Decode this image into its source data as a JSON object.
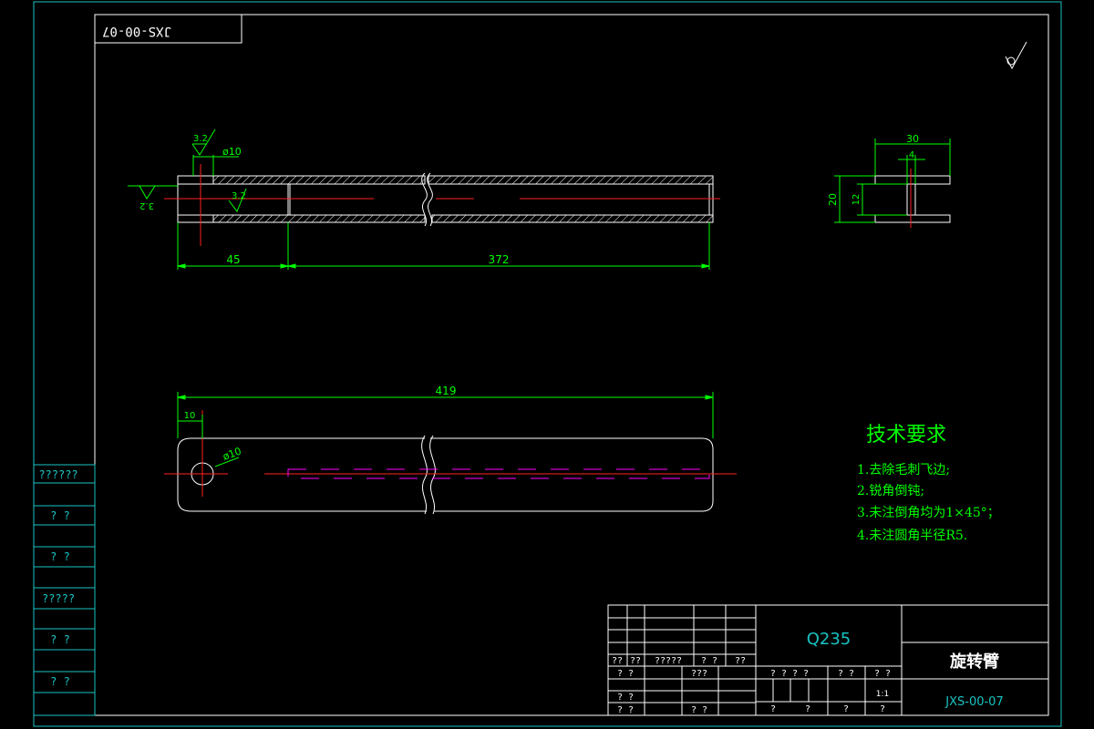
{
  "colors": {
    "background": "#000000",
    "border": "#19c3c3",
    "outline": "#ffffff",
    "dimension": "#00ff00",
    "centerline": "#ff2020",
    "hidden": "#ff00ff",
    "note": "#00ff00",
    "title_text": "#00ff00"
  },
  "corner_label": "JXS-00-07",
  "dims": {
    "top_dia": "ø10",
    "rough_top": "3.2",
    "rough_left": "3.2",
    "rough_mid": "3.2",
    "len_45": "45",
    "len_372": "372",
    "side_30": "30",
    "side_4": "4",
    "side_20": "20",
    "side_12": "12",
    "len_419": "419",
    "len_10": "10",
    "hole_dia": "ø10"
  },
  "tech": {
    "title": "技术要求",
    "items": [
      "1.去除毛刺飞边;",
      "2.锐角倒钝;",
      "3.未注倒角均为1×45°；",
      "4.未注圆角半径R5."
    ]
  },
  "left_strip": [
    "??????",
    "?  ?",
    "?  ?",
    "?????",
    "?  ?",
    "?  ?"
  ],
  "title_block": {
    "material": "Q235",
    "part_name": "旋转臂",
    "drawing_no": "JXS-00-07",
    "scale": "1:1",
    "sign_row_1": [
      "??",
      "??",
      "?????",
      "? ?",
      "??"
    ],
    "sign_row_2": [
      "? ?",
      "???"
    ],
    "sign_row_3": [
      "? ?"
    ],
    "sign_row_4": [
      "? ?",
      "? ?"
    ],
    "mid_row_labels": [
      "? ? ? ?",
      "? ?",
      "? ?"
    ],
    "bottom_row_labels": [
      "?",
      "?",
      "?",
      "?"
    ]
  }
}
